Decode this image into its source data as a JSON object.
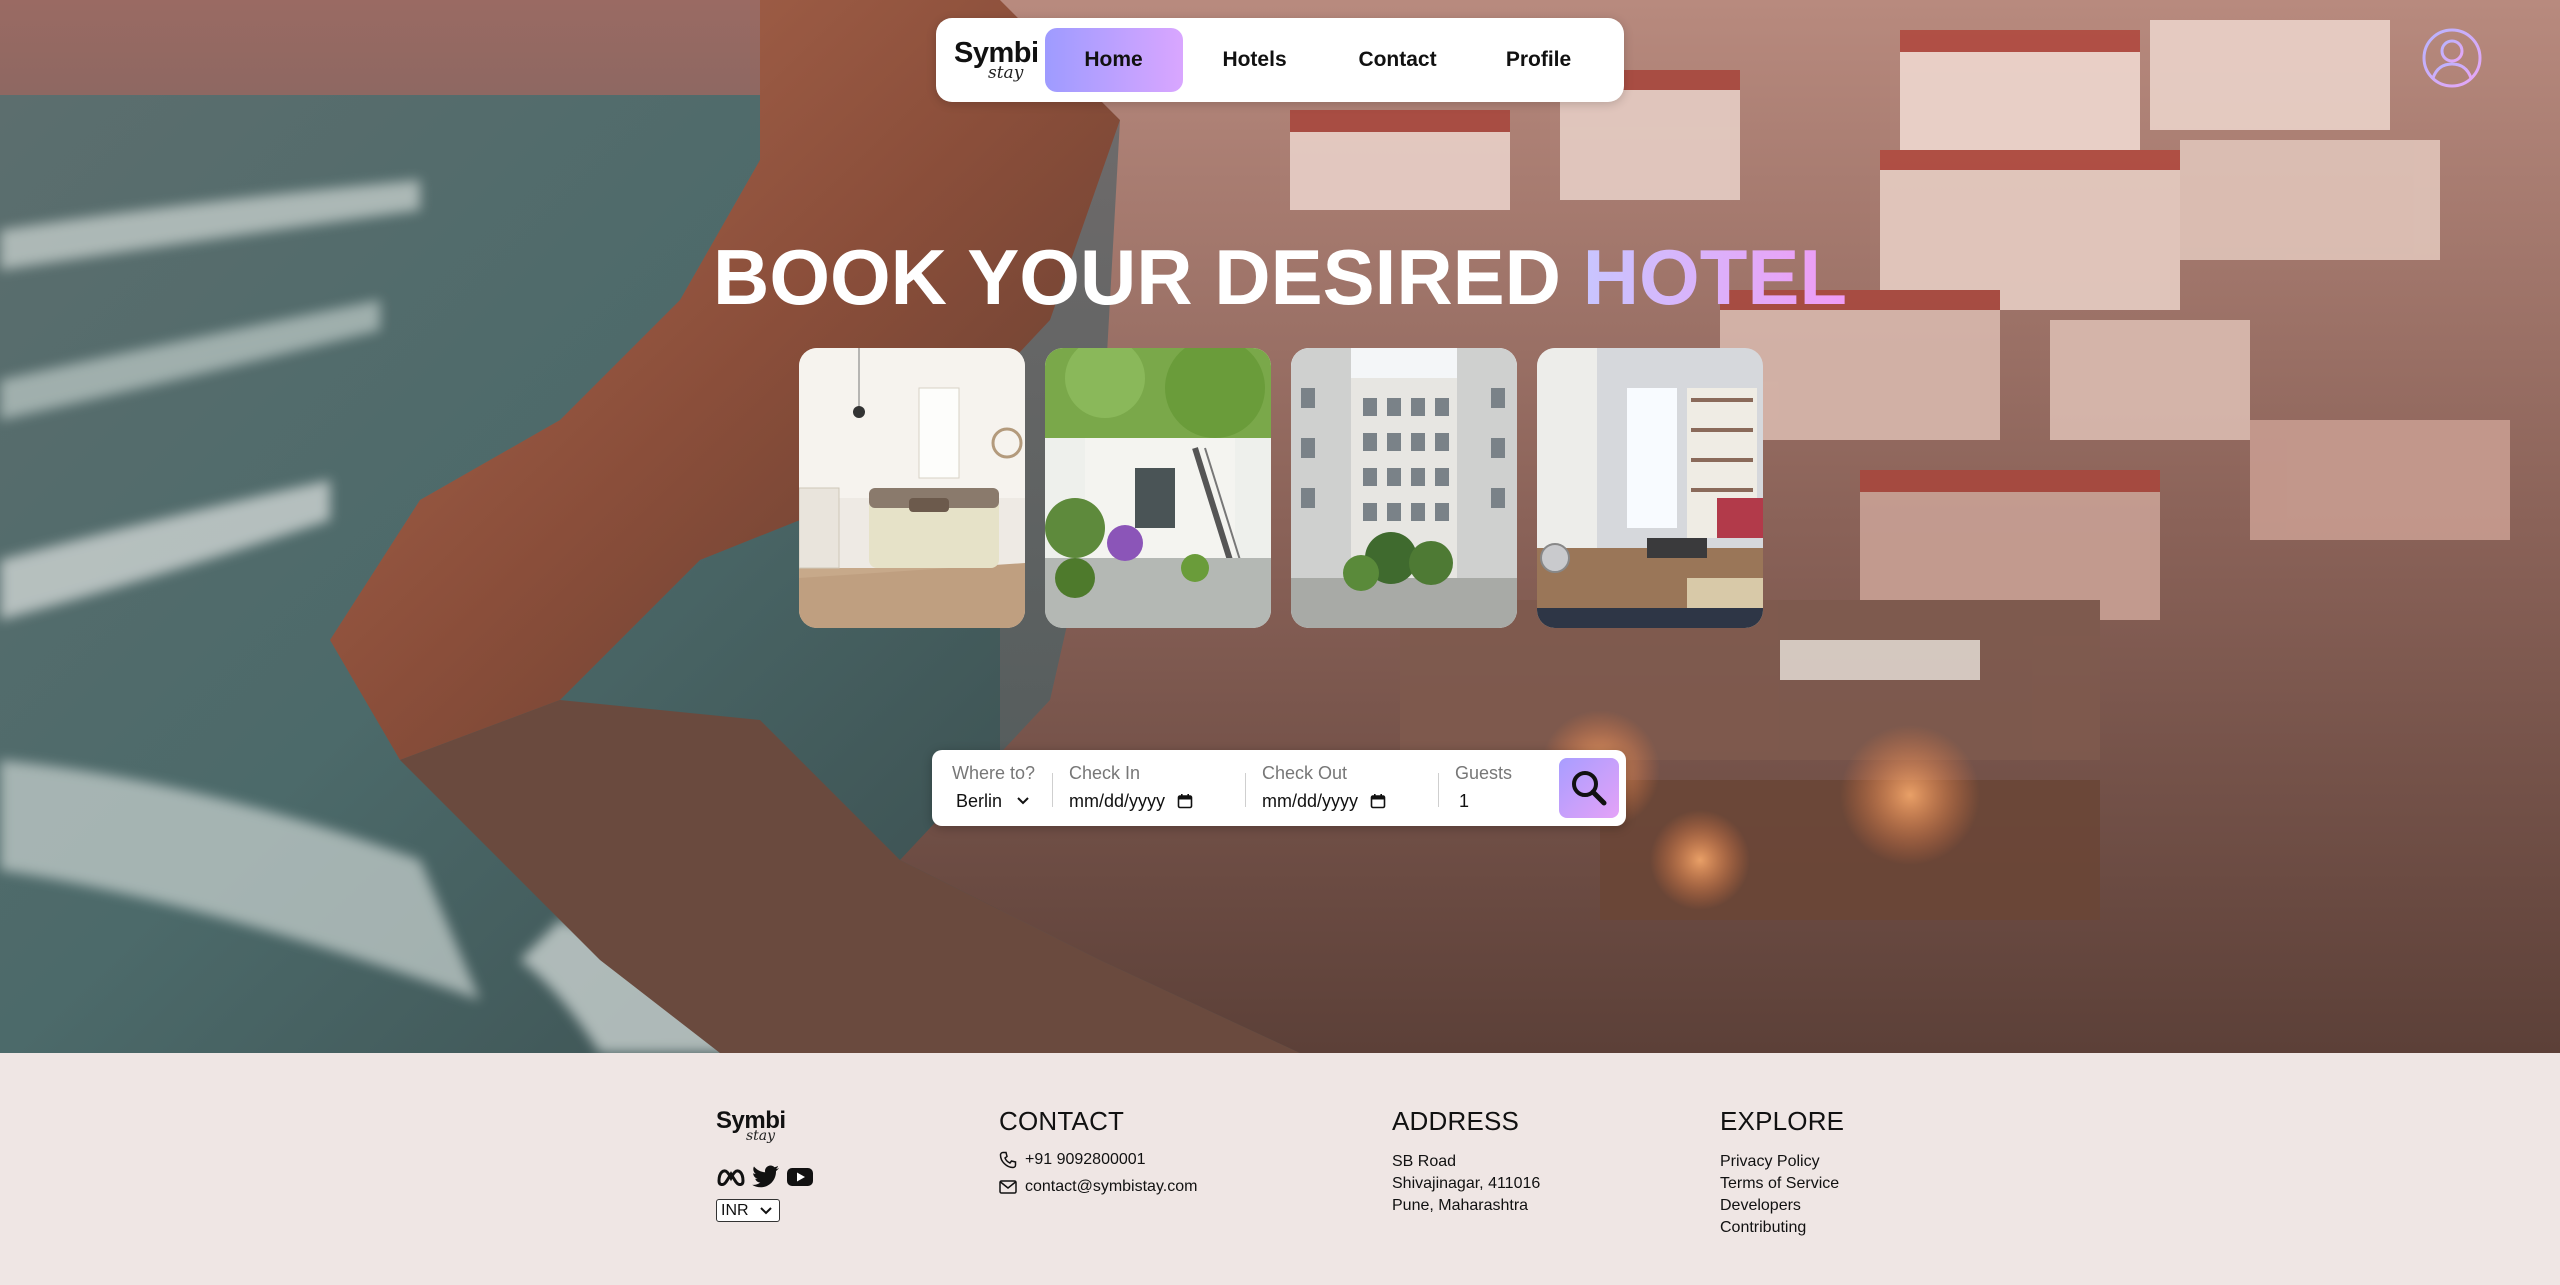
{
  "brand": {
    "name": "Symbi",
    "script": "stay"
  },
  "nav": {
    "items": [
      {
        "label": "Home",
        "active": true
      },
      {
        "label": "Hotels",
        "active": false
      },
      {
        "label": "Contact",
        "active": false
      },
      {
        "label": "Profile",
        "active": false
      }
    ],
    "profile_icon": "user-circle-icon"
  },
  "hero": {
    "headline_main": "BOOK YOUR DESIRED ",
    "headline_accent": "HOTEL",
    "photos": [
      "bedroom-photo",
      "courtyard-garden-photo",
      "building-courtyard-photo",
      "apartment-interior-photo"
    ]
  },
  "search": {
    "where_label": "Where to?",
    "where_value": "Berlin",
    "checkin_label": "Check In",
    "checkin_value": "mm/dd/yyyy",
    "checkout_label": "Check Out",
    "checkout_value": "mm/dd/yyyy",
    "guests_label": "Guests",
    "guests_value": "1",
    "button_icon": "search-icon"
  },
  "footer": {
    "currency": "INR",
    "social_icons": [
      "meta-icon",
      "twitter-icon",
      "youtube-icon"
    ],
    "contact": {
      "title": "CONTACT",
      "phone": "+91 9092800001",
      "email": "contact@symbistay.com"
    },
    "address": {
      "title": "ADDRESS",
      "lines": [
        "SB Road",
        "Shivajinagar, 411016",
        "Pune, Maharashtra"
      ]
    },
    "explore": {
      "title": "EXPLORE",
      "links": [
        "Privacy Policy",
        "Terms of Service",
        "Developers",
        "Contributing"
      ]
    }
  },
  "colors": {
    "accent_start": "#9e9bff",
    "accent_end": "#d9a6ff",
    "footer_bg": "#efe6e4"
  }
}
